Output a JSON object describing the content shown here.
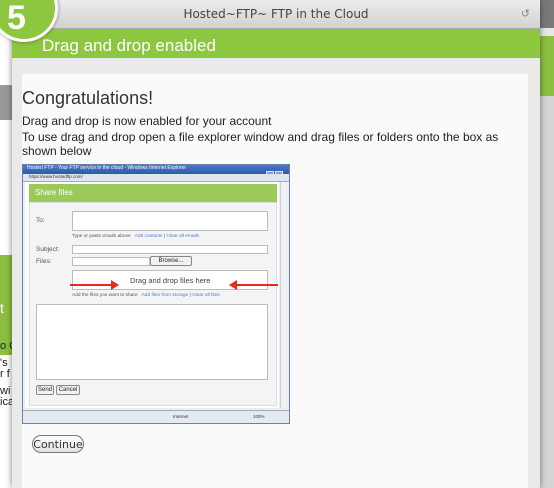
{
  "step": "5",
  "window": {
    "title": "Hosted~FTP~ FTP in the Cloud"
  },
  "header": {
    "title": "Drag and drop enabled"
  },
  "main": {
    "heading": "Congratulations!",
    "line1": "Drag and drop is now enabled for your account",
    "line2": "To use drag and drop open a file explorer window and drag files or folders onto the box as shown below",
    "continue_label": "Continue"
  },
  "screenshot": {
    "title": "Hosted FTP - Your FTP service in the cloud - Windows Internet Explorer",
    "address": "https://www.hostedftp.com/",
    "share_title": "Share files",
    "to_label": "To:",
    "to_hint": "Type or paste emails above",
    "add_contacts": "Add contacts",
    "clear_emails": "Clear all emails",
    "subject_label": "Subject:",
    "files_label": "Files:",
    "browse_label": "Browse...",
    "drop_text": "Drag and drop files here",
    "files_hint": "Add the files you want to share",
    "add_storage": "Add files from storage",
    "clear_files": "Clear all files",
    "send_label": "Send",
    "cancel_label": "Cancel",
    "status_zone": "Internet",
    "status_zoom": "100%"
  },
  "background": {
    "left_fragments": [
      "t",
      "o C",
      "'s",
      "r f",
      "wi",
      "ica"
    ]
  },
  "colors": {
    "accent_green": "#8dc63f",
    "arrow_red": "#e8291c"
  }
}
